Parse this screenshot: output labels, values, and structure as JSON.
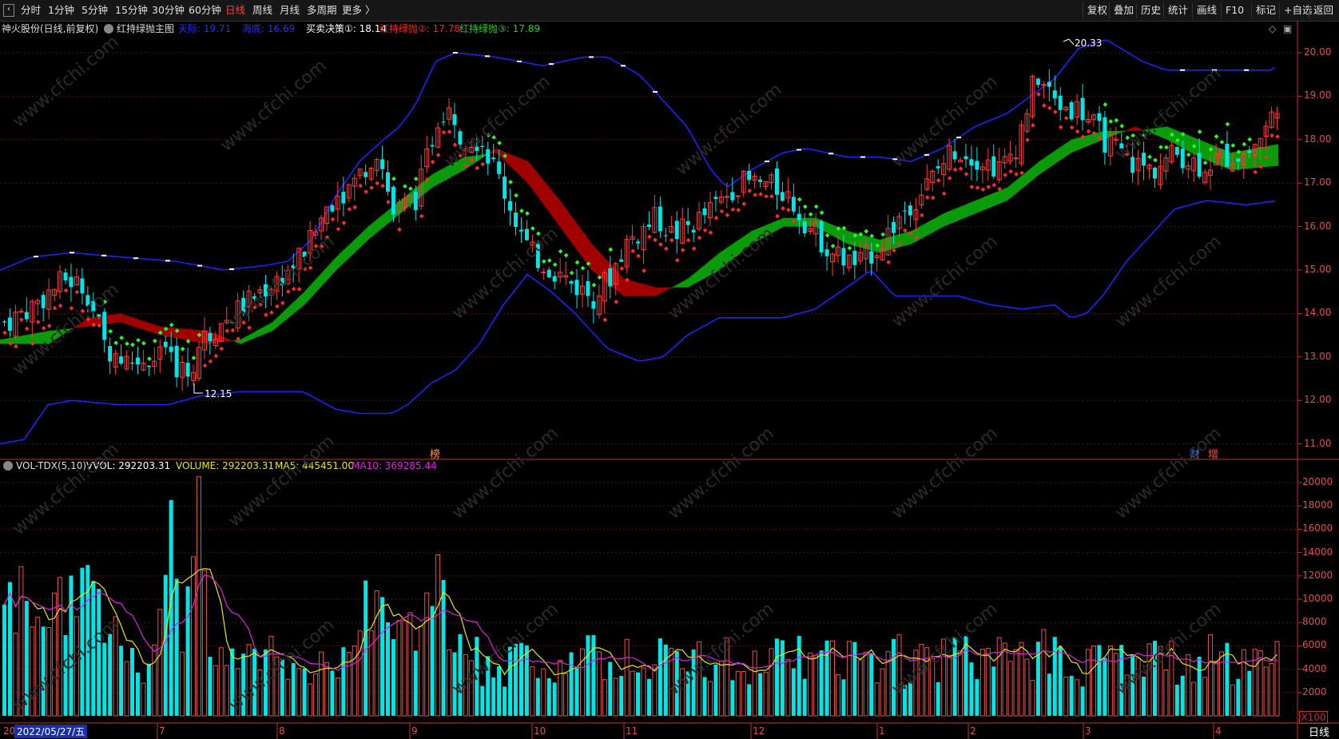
{
  "toolbar": {
    "periods": [
      "分时",
      "1分钟",
      "5分钟",
      "15分钟",
      "30分钟",
      "60分钟",
      "日线",
      "周线",
      "月线",
      "多周期",
      "更多 〉"
    ],
    "active_period": "日线",
    "right_buttons": [
      "复权",
      "叠加",
      "历史",
      "统计",
      "画线",
      "F10",
      "+自选",
      "返回"
    ],
    "mark_button": "标记"
  },
  "main_legend": {
    "stock": "神火股份(日线,前复权)",
    "indicator": "红持绿抛主图",
    "items": [
      {
        "label": "天际: 19.71",
        "color": "#2a2aff"
      },
      {
        "label": "海底: 16.69",
        "color": "#2a2aff"
      },
      {
        "label": "买卖决策①: 18.14",
        "color": "#ffffff"
      },
      {
        "label": "红持绿抛②: 17.78",
        "color": "#ff2020"
      },
      {
        "label": "红持绿抛③: 17.89",
        "color": "#20d020"
      }
    ]
  },
  "volume_legend": {
    "name": "VOL-TDX(5,10)",
    "items": [
      {
        "label": "VVOL: 292203.31",
        "color": "#ffffff"
      },
      {
        "label": "VOLUME: 292203.31",
        "color": "#e8e800"
      },
      {
        "label": "MA5: 445451.00",
        "color": "#e8e800"
      },
      {
        "label": "MA10: 369285.44",
        "color": "#e020e0"
      }
    ]
  },
  "price_axis": [
    "20.00",
    "19.00",
    "18.00",
    "17.00",
    "16.00",
    "15.00",
    "14.00",
    "13.00",
    "12.00",
    "11.00"
  ],
  "volume_axis": [
    "20000",
    "18000",
    "16000",
    "14000",
    "12000",
    "10000",
    "8000",
    "6000",
    "4000",
    "2000"
  ],
  "volume_unit": "X100",
  "x_labels": {
    "current_date": "2022/05/27/五",
    "left_cut": "20",
    "months": [
      "7",
      "8",
      "9",
      "10",
      "11",
      "12",
      "1",
      "2",
      "3",
      "4"
    ]
  },
  "annotations": {
    "high": "20.33",
    "low": "12.15"
  },
  "markers": {
    "bang": "榜",
    "cai": "财",
    "zeng": "增"
  },
  "status": {
    "period": "日线"
  },
  "watermark": "www.cfchi.com",
  "colors": {
    "up": "#ff3b3b",
    "down": "#00e5e5",
    "upper_band": "#2020ff",
    "green_band": "#0a9a0a",
    "red_band": "#a00000",
    "ma5": "#e8e800",
    "ma10": "#e020e0",
    "axis": "#c03030",
    "grid": "#5a0f0f"
  }
}
